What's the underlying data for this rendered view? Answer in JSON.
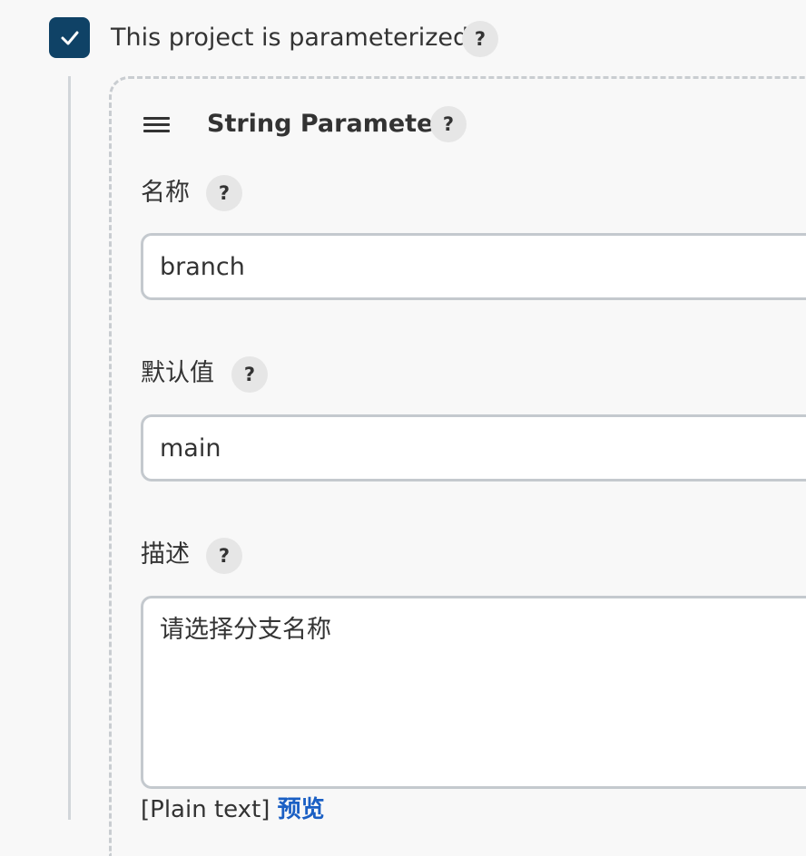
{
  "parameterized": {
    "checked": true,
    "label": "This project is parameterized",
    "help": "?"
  },
  "parameter": {
    "title": "String Parameter",
    "help": "?",
    "name_field": {
      "label": "名称",
      "help": "?",
      "value": "branch"
    },
    "default_field": {
      "label": "默认值",
      "help": "?",
      "value": "main"
    },
    "description_field": {
      "label": "描述",
      "help": "?",
      "value": "请选择分支名称"
    },
    "format_note": "[Plain text]",
    "preview_link": "预览"
  },
  "colors": {
    "checkbox": "#0f4266",
    "link": "#1a5fc4",
    "help_bg": "#e6e6e6"
  }
}
